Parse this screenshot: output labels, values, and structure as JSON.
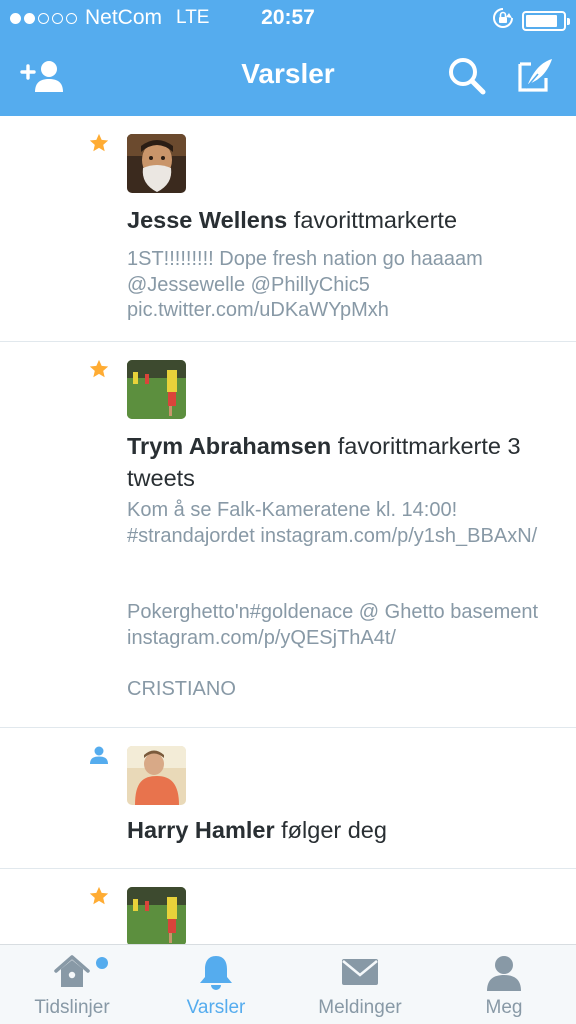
{
  "status_bar": {
    "carrier": "NetCom",
    "network": "LTE",
    "time": "20:57",
    "signal_bars_filled": 2,
    "signal_bars_total": 5,
    "battery_level": 0.85
  },
  "nav": {
    "title": "Varsler",
    "left_icon": "add-user-icon",
    "right_icons": [
      "search-icon",
      "compose-icon"
    ]
  },
  "notifications": [
    {
      "type": "favorite",
      "icon": "star-icon",
      "name": "Jesse Wellens",
      "action": "favorittmarkerte",
      "tweets": [
        "1ST!!!!!!!!! Dope fresh nation go haaaam @Jessewelle @PhillyChic5 pic.twitter.com/uDKaWYpMxh"
      ]
    },
    {
      "type": "favorite",
      "icon": "star-icon",
      "name": "Trym Abrahamsen",
      "action": "favorittmarkerte 3 tweets",
      "tweets": [
        "Kom å se Falk-Kameratene kl. 14:00! #strandajordet instagram.com/p/y1sh_BBAxN/",
        "Pokerghetto'n#goldenace @ Ghetto basement instagram.com/p/yQESjThA4t/",
        "CRISTIANO"
      ]
    },
    {
      "type": "follow",
      "icon": "person-icon",
      "name": "Harry Hamler",
      "action": "følger deg",
      "tweets": []
    },
    {
      "type": "favorite",
      "icon": "star-icon",
      "name": "",
      "action": "",
      "tweets": []
    }
  ],
  "tabs": [
    {
      "label": "Tidslinjer",
      "icon": "home-icon",
      "active": false,
      "has_dot": true
    },
    {
      "label": "Varsler",
      "icon": "bell-icon",
      "active": true,
      "has_dot": false
    },
    {
      "label": "Meldinger",
      "icon": "envelope-icon",
      "active": false,
      "has_dot": false
    },
    {
      "label": "Meg",
      "icon": "person-icon",
      "active": false,
      "has_dot": false
    }
  ],
  "colors": {
    "brand": "#55acee",
    "star": "#ffac33",
    "text": "#292f33",
    "muted": "#8899a6"
  }
}
